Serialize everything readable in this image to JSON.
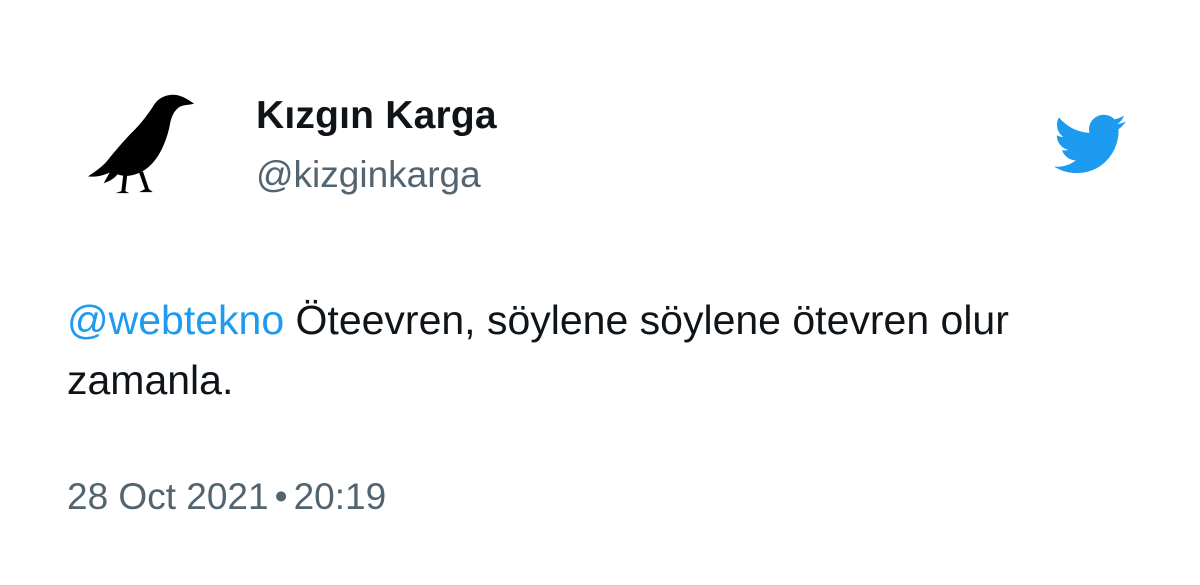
{
  "tweet": {
    "display_name": "Kızgın Karga",
    "handle": "@kizginkarga",
    "mention": "@webtekno",
    "text": " Öteevren, söylene söylene ötevren olur zamanla.",
    "date": "28 Oct 2021",
    "separator": "•",
    "time": "20:19"
  },
  "icons": {
    "avatar": "crow-icon",
    "brand": "twitter-bird-icon"
  },
  "colors": {
    "mention": "#1d9bf0",
    "brand": "#1d9bf0",
    "secondary_text": "#536471",
    "primary_text": "#0f1419"
  }
}
